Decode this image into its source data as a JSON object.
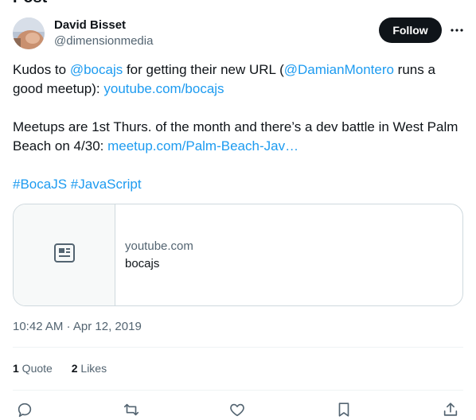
{
  "page": {
    "header_title": "Post"
  },
  "author": {
    "name": "David Bisset",
    "handle": "@dimensionmedia",
    "follow_label": "Follow",
    "more_icon": "more-horizontal-icon"
  },
  "tweet": {
    "p1": {
      "t1": "Kudos to ",
      "m1": "@bocajs",
      "t2": " for getting their new URL (",
      "m2": "@DamianMontero",
      "t3": " runs a good meetup): ",
      "l1": "youtube.com/bocajs"
    },
    "p2": {
      "t1": "Meetups are 1st Thurs. of the month and there’s a dev battle in West Palm Beach on 4/30: ",
      "l1": "meetup.com/Palm-Beach-Jav…"
    },
    "hashtags": [
      "#BocaJS",
      "#JavaScript"
    ]
  },
  "card": {
    "icon": "article-icon",
    "domain": "youtube.com",
    "title": "bocajs"
  },
  "meta": {
    "time": "10:42 AM",
    "separator": " · ",
    "date": "Apr 12, 2019"
  },
  "stats": {
    "quotes_count": "1",
    "quotes_label": " Quote",
    "likes_count": "2",
    "likes_label": " Likes"
  },
  "actions": [
    "reply-icon",
    "retweet-icon",
    "like-icon",
    "bookmark-icon",
    "share-icon"
  ],
  "colors": {
    "accent": "#1d9bf0",
    "text": "#0f1419",
    "muted": "#536471",
    "border": "#cfd9de",
    "divider": "#eff3f4"
  }
}
